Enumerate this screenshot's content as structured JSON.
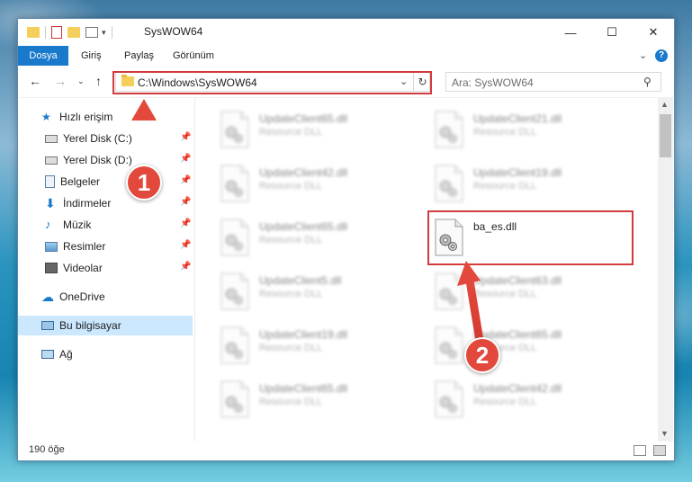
{
  "window": {
    "title": "SysWOW64"
  },
  "ribbon": {
    "tabs": [
      "Dosya",
      "Giriş",
      "Paylaş",
      "Görünüm"
    ]
  },
  "navigation": {
    "address": "C:\\Windows\\SysWOW64",
    "search_placeholder": "Ara: SysWOW64"
  },
  "sidebar": {
    "items": [
      {
        "label": "Hızlı erişim",
        "icon": "star-icon",
        "pinned": false
      },
      {
        "label": "Yerel Disk (C:)",
        "icon": "drive-icon",
        "pinned": true
      },
      {
        "label": "Yerel Disk (D:)",
        "icon": "drive-icon",
        "pinned": true
      },
      {
        "label": "Belgeler",
        "icon": "document-icon",
        "pinned": true
      },
      {
        "label": "İndirmeler",
        "icon": "download-icon",
        "pinned": true
      },
      {
        "label": "Müzik",
        "icon": "music-icon",
        "pinned": true
      },
      {
        "label": "Resimler",
        "icon": "picture-icon",
        "pinned": true
      },
      {
        "label": "Videolar",
        "icon": "video-icon",
        "pinned": true
      },
      {
        "label": "OneDrive",
        "icon": "cloud-icon",
        "pinned": false
      },
      {
        "label": "Bu bilgisayar",
        "icon": "computer-icon",
        "pinned": false,
        "selected": true
      },
      {
        "label": "Ağ",
        "icon": "network-icon",
        "pinned": false
      }
    ]
  },
  "files": [
    {
      "name": "UpdateClient65.dll",
      "type": "Resource DLL",
      "blurred": true
    },
    {
      "name": "UpdateClient21.dll",
      "type": "Resource DLL",
      "blurred": true
    },
    {
      "name": "UpdateClient42.dll",
      "type": "Resource DLL",
      "blurred": true
    },
    {
      "name": "UpdateClient19.dll",
      "type": "Resource DLL",
      "blurred": true
    },
    {
      "name": "UpdateClient65.dll",
      "type": "Resource DLL",
      "blurred": true
    },
    {
      "name": "ba_es.dll",
      "type": "",
      "blurred": false
    },
    {
      "name": "UpdateClient5.dll",
      "type": "Resource DLL",
      "blurred": true
    },
    {
      "name": "UpdateClient63.dll",
      "type": "Resource DLL",
      "blurred": true
    },
    {
      "name": "UpdateClient19.dll",
      "type": "Resource DLL",
      "blurred": true
    },
    {
      "name": "UpdateClient65.dll",
      "type": "Resource DLL",
      "blurred": true
    },
    {
      "name": "UpdateClient65.dll",
      "type": "Resource DLL",
      "blurred": true
    },
    {
      "name": "UpdateClient42.dll",
      "type": "Resource DLL",
      "blurred": true
    }
  ],
  "status": {
    "count": "190 öğe"
  },
  "annotations": {
    "marker1": "1",
    "marker2": "2",
    "color": "#e2483c"
  }
}
